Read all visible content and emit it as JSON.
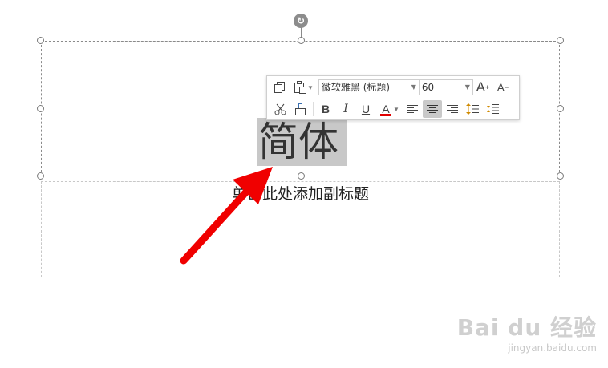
{
  "slide": {
    "title_text": "简体",
    "subtitle_placeholder": "单击此处添加副标题"
  },
  "mini_toolbar": {
    "font_name": "微软雅黑 (标题)",
    "font_size": "60",
    "buttons": {
      "bold": "B",
      "italic": "I",
      "underline": "U",
      "font_color": "A",
      "grow_font": "A",
      "shrink_font": "A"
    },
    "font_color_hex": "#e00000"
  },
  "annotation": {
    "arrow_color": "#f00000"
  },
  "watermark": {
    "brand": "Bai du 经验",
    "url": "jingyan.baidu.com"
  }
}
